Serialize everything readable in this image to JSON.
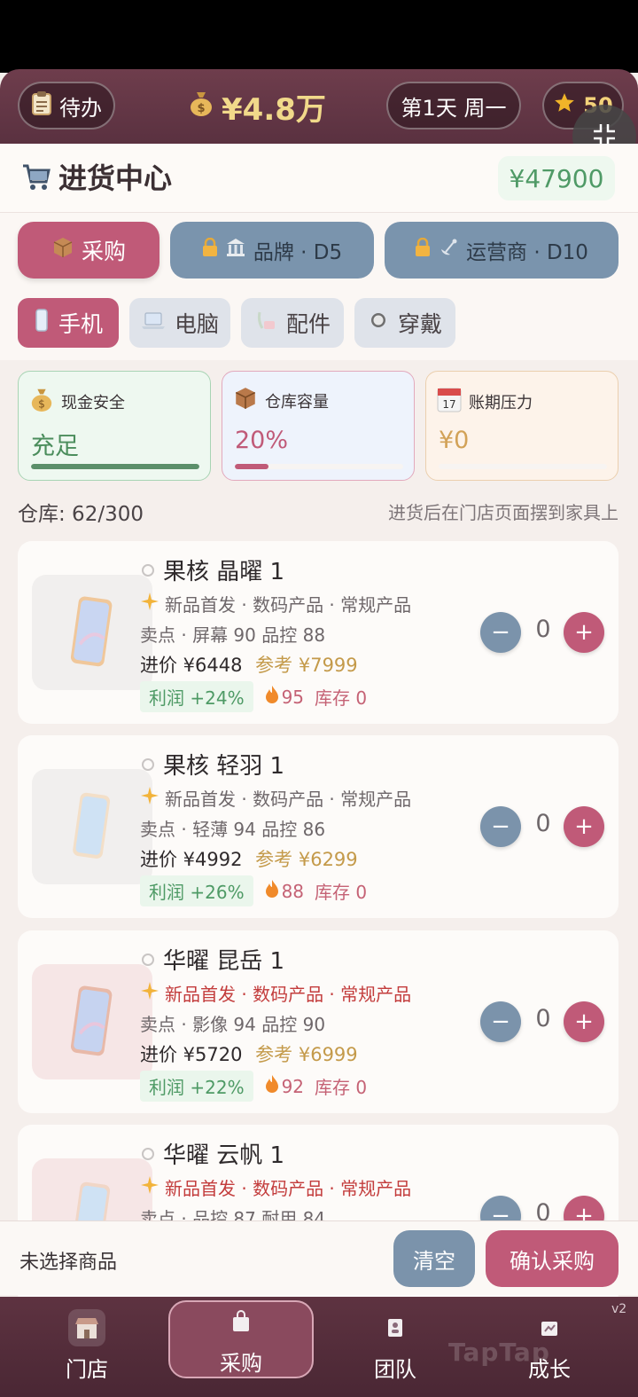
{
  "topbar": {
    "todo_label": "待办",
    "money": "¥4.8万",
    "day": "第1天 周一",
    "stars": "50"
  },
  "header": {
    "title": "进货中心",
    "balance": "¥47900"
  },
  "modes": [
    {
      "label": "采购",
      "locked": false,
      "active": true
    },
    {
      "label": "品牌 · D5",
      "locked": true,
      "active": false
    },
    {
      "label": "运营商 · D10",
      "locked": true,
      "active": false
    }
  ],
  "categories": [
    {
      "label": "手机",
      "active": true
    },
    {
      "label": "电脑",
      "active": false
    },
    {
      "label": "配件",
      "active": false
    },
    {
      "label": "穿戴",
      "active": false
    }
  ],
  "stats": {
    "cash": {
      "label": "现金安全",
      "value": "充足",
      "level": 1.0
    },
    "warehouse": {
      "label": "仓库容量",
      "value": "20%",
      "level": 0.2
    },
    "payables": {
      "label": "账期压力",
      "value": "¥0",
      "level": 0.0
    }
  },
  "warehouse_line": "仓库: 62/300",
  "warehouse_hint": "进货后在门店页面摆到家具上",
  "products": [
    {
      "name": "果核 晶曜 1",
      "tags": "新品首发 · 数码产品 · 常规产品",
      "specs": "卖点 · 屏幕 90  品控 88",
      "cost": "进价 ¥6448",
      "ref": "参考 ¥7999",
      "profit": "利润 +24%",
      "heat": "95",
      "stock": "库存 0",
      "qty": "0"
    },
    {
      "name": "果核 轻羽 1",
      "tags": "新品首发 · 数码产品 · 常规产品",
      "specs": "卖点 · 轻薄 94  品控 86",
      "cost": "进价 ¥4992",
      "ref": "参考 ¥6299",
      "profit": "利润 +26%",
      "heat": "88",
      "stock": "库存 0",
      "qty": "0"
    },
    {
      "name": "华曜 昆岳 1",
      "tags": "新品首发 · 数码产品 · 常规产品",
      "specs": "卖点 · 影像 94  品控 90",
      "cost": "进价 ¥5720",
      "ref": "参考 ¥6999",
      "profit": "利润 +22%",
      "heat": "92",
      "stock": "库存 0",
      "qty": "0"
    },
    {
      "name": "华曜 云帆 1",
      "tags": "新品首发 · 数码产品 · 常规产品",
      "specs": "卖点 · 品控 87  耐用 84",
      "qty": "0"
    }
  ],
  "action_bar": {
    "selection": "未选择商品",
    "clear": "清空",
    "confirm": "确认采购"
  },
  "tabs": [
    {
      "label": "门店"
    },
    {
      "label": "采购"
    },
    {
      "label": "团队"
    },
    {
      "label": "成长"
    }
  ],
  "version": "v2",
  "watermark": "TapTap"
}
